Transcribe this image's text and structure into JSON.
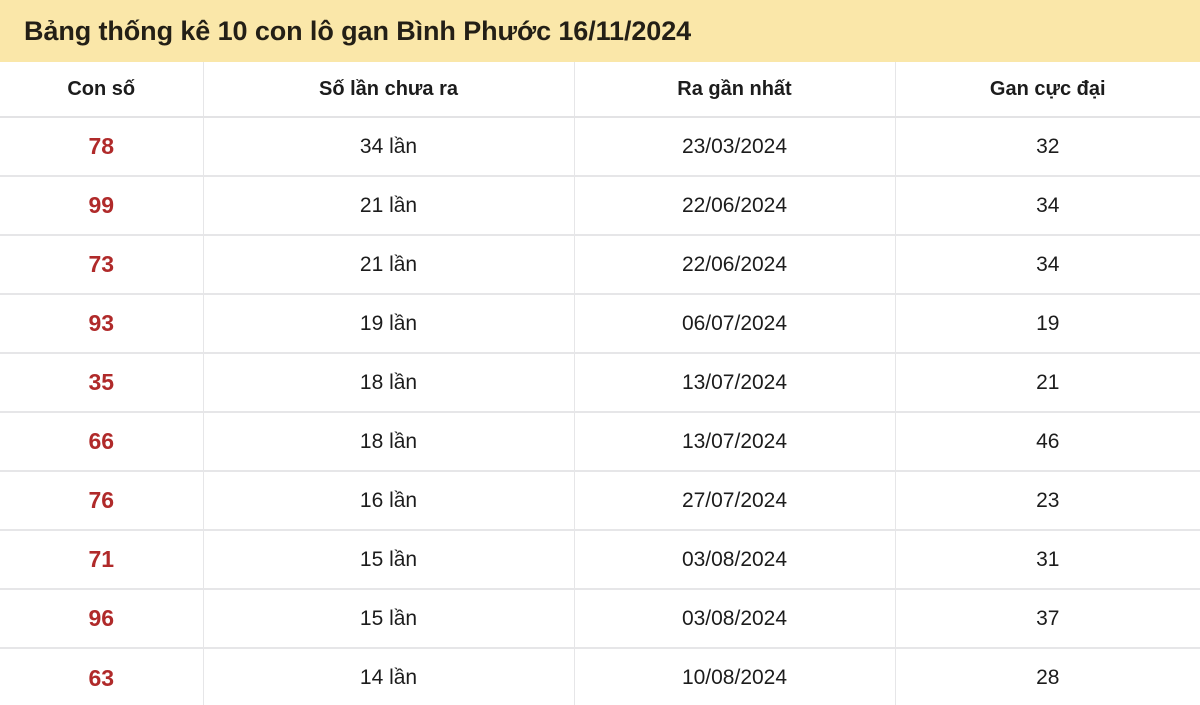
{
  "header": {
    "title": "Bảng thống kê 10 con lô gan Bình Phước 16/11/2024",
    "band_color": "#fae7a9",
    "text_color": "#231f16"
  },
  "table": {
    "columns": [
      {
        "key": "number",
        "label": "Con số"
      },
      {
        "key": "miss_count",
        "label": "Số lần chưa ra"
      },
      {
        "key": "last_seen",
        "label": "Ra gần nhất"
      },
      {
        "key": "max_gan",
        "label": "Gan cực đại"
      }
    ],
    "accent_color": "#b02a2a",
    "grid_color": "#e6e6e8",
    "rows": [
      {
        "number": "78",
        "miss_count": "34 lần",
        "last_seen": "23/03/2024",
        "max_gan": "32"
      },
      {
        "number": "99",
        "miss_count": "21 lần",
        "last_seen": "22/06/2024",
        "max_gan": "34"
      },
      {
        "number": "73",
        "miss_count": "21 lần",
        "last_seen": "22/06/2024",
        "max_gan": "34"
      },
      {
        "number": "93",
        "miss_count": "19 lần",
        "last_seen": "06/07/2024",
        "max_gan": "19"
      },
      {
        "number": "35",
        "miss_count": "18 lần",
        "last_seen": "13/07/2024",
        "max_gan": "21"
      },
      {
        "number": "66",
        "miss_count": "18 lần",
        "last_seen": "13/07/2024",
        "max_gan": "46"
      },
      {
        "number": "76",
        "miss_count": "16 lần",
        "last_seen": "27/07/2024",
        "max_gan": "23"
      },
      {
        "number": "71",
        "miss_count": "15 lần",
        "last_seen": "03/08/2024",
        "max_gan": "31"
      },
      {
        "number": "96",
        "miss_count": "15 lần",
        "last_seen": "03/08/2024",
        "max_gan": "37"
      },
      {
        "number": "63",
        "miss_count": "14 lần",
        "last_seen": "10/08/2024",
        "max_gan": "28"
      }
    ]
  }
}
